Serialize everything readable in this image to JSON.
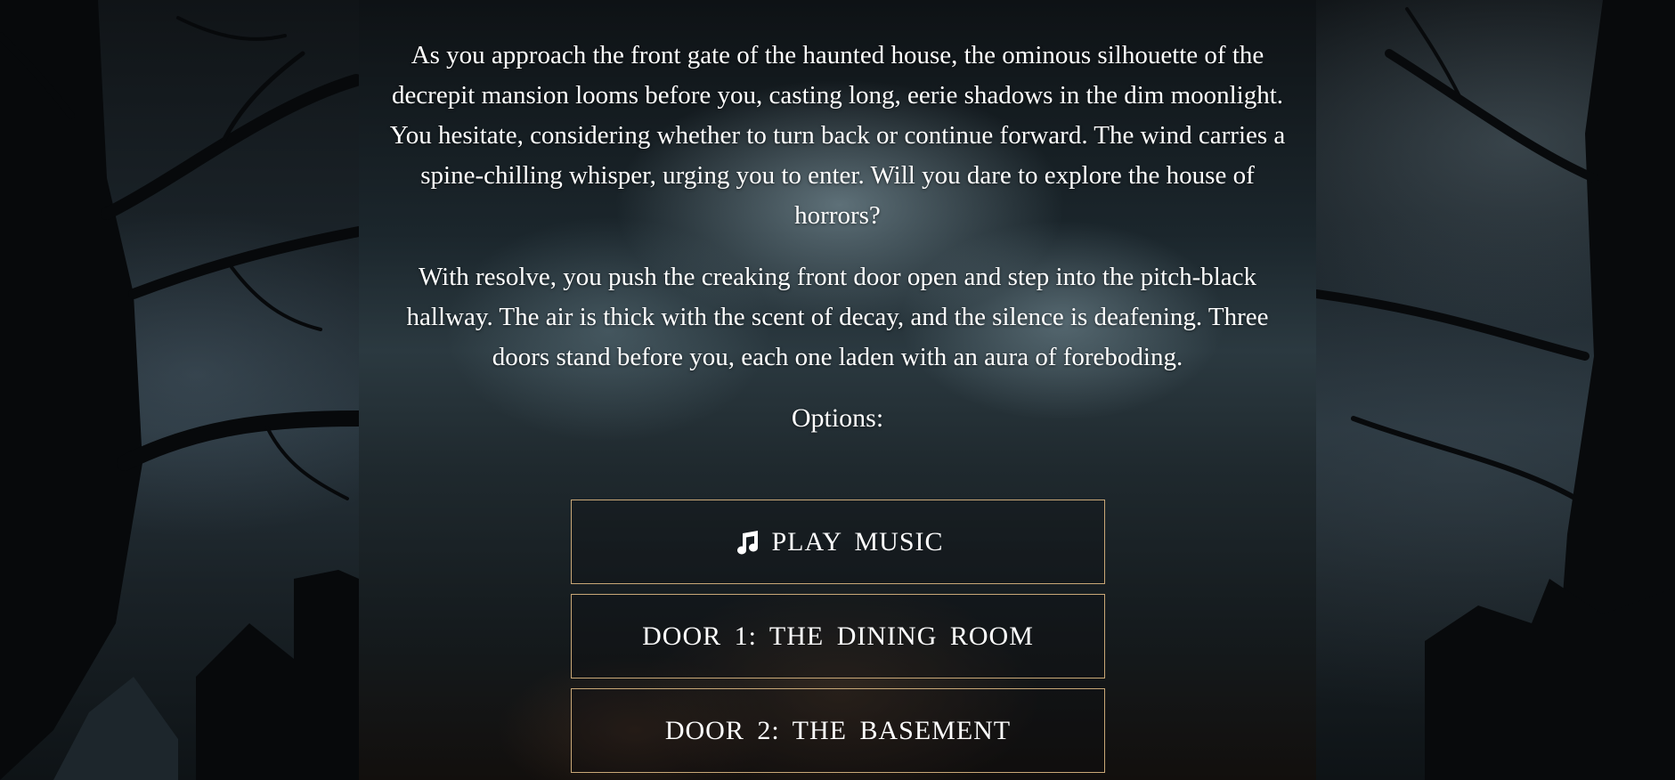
{
  "story": {
    "paragraph1": "As you approach the front gate of the haunted house, the ominous silhouette of the decrepit mansion looms before you, casting long, eerie shadows in the dim moonlight. You hesitate, considering whether to turn back or continue forward. The wind carries a spine-chilling whisper, urging you to enter. Will you dare to explore the house of horrors?",
    "paragraph2": "With resolve, you push the creaking front door open and step into the pitch-black hallway. The air is thick with the scent of decay, and the silence is deafening. Three doors stand before you, each one laden with an aura of foreboding."
  },
  "options": {
    "label": "Options:",
    "play_music_label": "PLAY MUSIC",
    "play_music_icon": "music-note-icon",
    "items": [
      {
        "label": "DOOR 1: THE DINING ROOM"
      },
      {
        "label": "DOOR 2: THE BASEMENT"
      }
    ]
  },
  "colors": {
    "button_border": "#c9a877",
    "text": "#ffffff"
  }
}
